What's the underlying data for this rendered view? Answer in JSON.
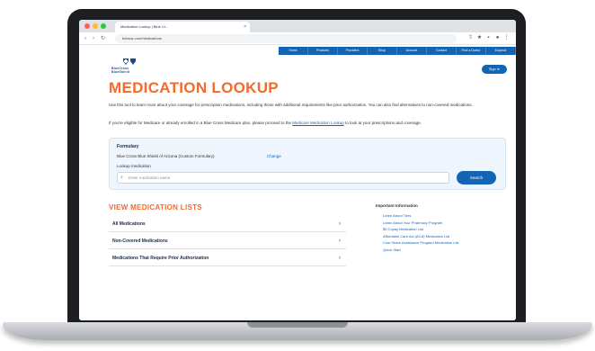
{
  "browser": {
    "tab_title": "Medication Lookup | Blue Cr...",
    "tab_close": "×",
    "url": "bcbsaz.com/medications",
    "nav_back": "‹",
    "nav_forward": "›",
    "nav_reload": "↻"
  },
  "topnav": {
    "items": [
      "Home",
      "Products",
      "Providers",
      "Shop",
      "Account",
      "Contact",
      "Find a Doctor",
      "Espanol"
    ]
  },
  "header": {
    "logo_text": "BlueCross BlueShield",
    "signin_label": "Sign In"
  },
  "main": {
    "title": "MEDICATION LOOKUP",
    "intro": "Use this tool to learn more about your coverage for prescription medications, including those with additional requirements like prior authorization. You can also find alternatives to non-covered medications.",
    "intro2_before": "If you're eligible for Medicare or already enrolled in a Blue Cross Medicare plan, please proceed to the",
    "intro2_link": "Medicare Medication Lookup",
    "intro2_after": "to look at your prescriptions and coverage."
  },
  "formulary": {
    "label": "Formulary",
    "value": "Blue Cross Blue Shield of Arizona (Custom Formulary)",
    "change_link": "Change",
    "lookup_label": "Lookup medication",
    "input_placeholder": "Enter medication name",
    "search_button": "Search"
  },
  "lists": {
    "title": "VIEW MEDICATION LISTS",
    "items": [
      {
        "label": "All Medications",
        "chevron": "›"
      },
      {
        "label": "Non-Covered Medications",
        "chevron": "›"
      },
      {
        "label": "Medications That Require Prior Authorization",
        "chevron": "›"
      }
    ]
  },
  "info": {
    "heading": "Important Information",
    "links": [
      "Learn About Tiers",
      "Learn About Your Pharmacy Program",
      "$0 Copay Medication List",
      "Affordable Care Act (ACA) Medication List",
      "Cost Share Assistance Program Medication List",
      "Quick Start"
    ]
  },
  "colors": {
    "accent_orange": "#f26b2c",
    "brand_blue": "#1464b4"
  }
}
